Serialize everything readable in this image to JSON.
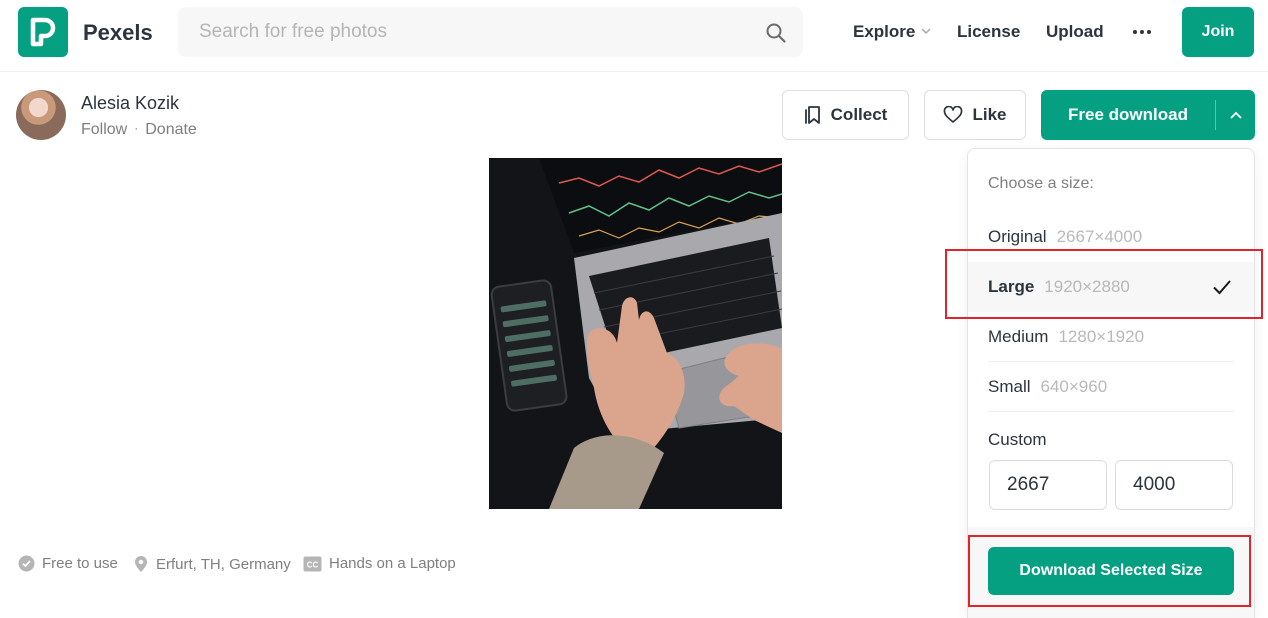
{
  "header": {
    "brand": "Pexels",
    "search_placeholder": "Search for free photos",
    "nav": {
      "explore": "Explore",
      "license": "License",
      "upload": "Upload"
    },
    "join_label": "Join"
  },
  "photographer": {
    "name": "Alesia Kozik",
    "follow": "Follow",
    "separator": "·",
    "donate": "Donate"
  },
  "actions": {
    "collect": "Collect",
    "like": "Like",
    "free_download": "Free download"
  },
  "download_menu": {
    "heading": "Choose a size:",
    "sizes": [
      {
        "name": "Original",
        "dims": "2667×4000",
        "selected": false
      },
      {
        "name": "Large",
        "dims": "1920×2880",
        "selected": true
      },
      {
        "name": "Medium",
        "dims": "1280×1920",
        "selected": false
      },
      {
        "name": "Small",
        "dims": "640×960",
        "selected": false
      }
    ],
    "custom_label": "Custom",
    "custom_width": "2667",
    "custom_height": "4000",
    "download_selected": "Download Selected Size"
  },
  "meta": {
    "free": "Free to use",
    "location": "Erfurt, TH, Germany",
    "title": "Hands on a Laptop"
  },
  "colors": {
    "accent": "#05a081",
    "highlight": "#e0242b"
  }
}
